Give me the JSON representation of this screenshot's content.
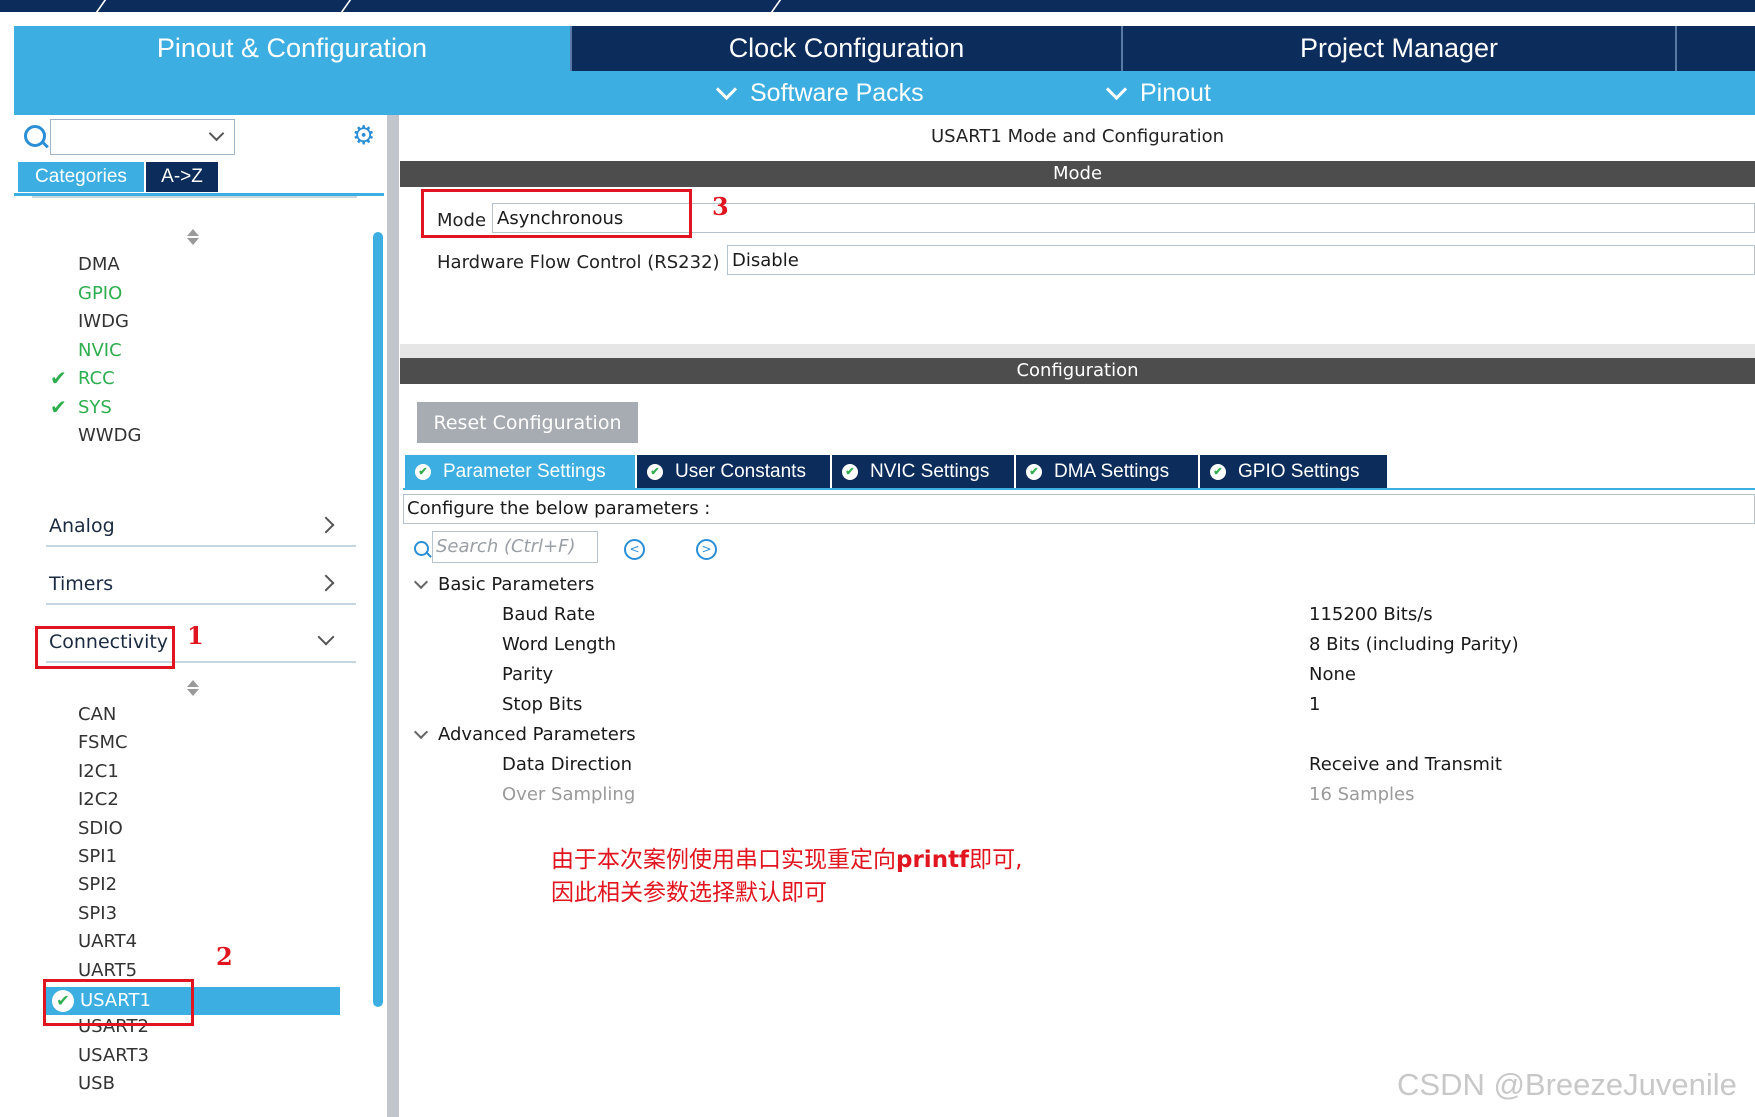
{
  "main_tabs": {
    "pinout": "Pinout & Configuration",
    "clock": "Clock Configuration",
    "project": "Project Manager"
  },
  "sub_menu": {
    "software_packs": "Software Packs",
    "pinout": "Pinout"
  },
  "left": {
    "tabs": {
      "categories": "Categories",
      "az": "A->Z"
    },
    "system_core_items": [
      {
        "label": "DMA",
        "state": "normal"
      },
      {
        "label": "GPIO",
        "state": "green"
      },
      {
        "label": "IWDG",
        "state": "normal"
      },
      {
        "label": "NVIC",
        "state": "green"
      },
      {
        "label": "RCC",
        "state": "checked"
      },
      {
        "label": "SYS",
        "state": "checked"
      },
      {
        "label": "WWDG",
        "state": "normal"
      }
    ],
    "groups": {
      "analog": "Analog",
      "timers": "Timers",
      "connectivity": "Connectivity"
    },
    "connectivity_items": [
      "CAN",
      "FSMC",
      "I2C1",
      "I2C2",
      "SDIO",
      "SPI1",
      "SPI2",
      "SPI3",
      "UART4",
      "UART5",
      "USART1",
      "USART2",
      "USART3",
      "USB"
    ],
    "selected": "USART1"
  },
  "right": {
    "title": "USART1 Mode and Configuration",
    "mode_header": "Mode",
    "mode_label": "Mode",
    "mode_value": "Asynchronous",
    "hwflow_label": "Hardware Flow Control (RS232)",
    "hwflow_value": "Disable",
    "config_header": "Configuration",
    "reset_button": "Reset Configuration",
    "tabs": [
      "Parameter Settings",
      "User Constants",
      "NVIC Settings",
      "DMA Settings",
      "GPIO Settings"
    ],
    "caption": "Configure the below parameters :",
    "search_placeholder": "Search (Ctrl+F)",
    "basic_header": "Basic Parameters",
    "basic": [
      {
        "name": "Baud Rate",
        "value": "115200 Bits/s"
      },
      {
        "name": "Word Length",
        "value": "8 Bits (including Parity)"
      },
      {
        "name": "Parity",
        "value": "None"
      },
      {
        "name": "Stop Bits",
        "value": "1"
      }
    ],
    "advanced_header": "Advanced Parameters",
    "advanced": [
      {
        "name": "Data Direction",
        "value": "Receive and Transmit"
      },
      {
        "name": "Over Sampling",
        "value": "16 Samples"
      }
    ]
  },
  "annotations": {
    "n1": "1",
    "n2": "2",
    "n3": "3",
    "note_line1_a": "由于本次案例使用串口实现重定向",
    "note_line1_b": "printf",
    "note_line1_c": "即可,",
    "note_line2": "因此相关参数选择默认即可"
  },
  "watermark": "CSDN @BreezeJuvenile",
  "colors": {
    "navy": "#0c2c5c",
    "accent": "#3daee2",
    "green": "#2fae4f",
    "annotation": "#e0151f"
  }
}
